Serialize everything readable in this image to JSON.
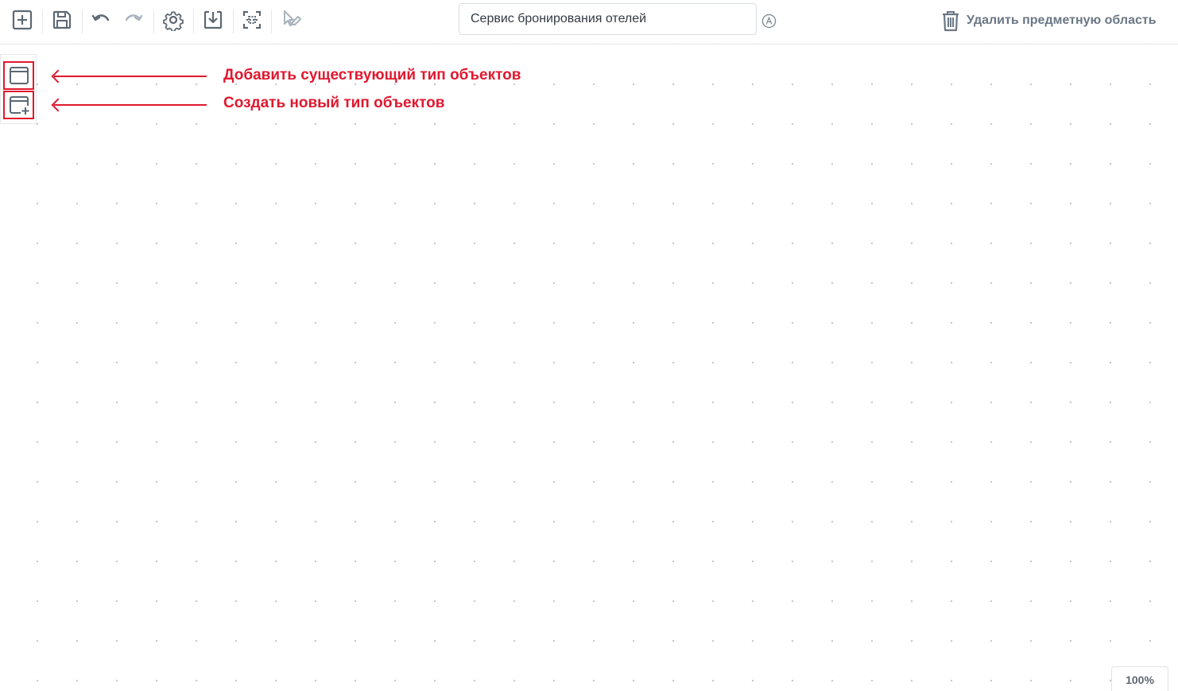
{
  "toolbar": {
    "buttons": [
      {
        "name": "new-button",
        "icon": "plus-square-icon"
      },
      {
        "name": "save-button",
        "icon": "floppy-disk-icon"
      },
      {
        "name": "undo-button",
        "icon": "undo-icon"
      },
      {
        "name": "redo-button",
        "icon": "redo-icon",
        "disabled": true
      },
      {
        "name": "settings-button",
        "icon": "gear-icon"
      },
      {
        "name": "download-button",
        "icon": "download-icon"
      },
      {
        "name": "fit-view-button",
        "icon": "fit-view-icon"
      },
      {
        "name": "edit-tool-button",
        "icon": "pencil-cursor-icon",
        "disabled": true
      }
    ],
    "title_value": "Сервис бронирования отелей",
    "auto_icon": "circle-a-icon",
    "delete_label": "Удалить предметную область",
    "delete_icon": "trash-icon"
  },
  "side_panel": {
    "add_existing_icon": "window-icon",
    "create_new_icon": "window-plus-icon"
  },
  "annotations": {
    "add_existing": "Добавить существующий тип объектов",
    "create_new": "Создать новый тип объектов",
    "color": "#e0182f"
  },
  "zoom": {
    "label": "100%",
    "value_percent": 100
  },
  "colors": {
    "icon": "#5d6873",
    "icon_disabled": "#a9b3bd",
    "accent_annotation": "#e0182f",
    "grid_dot": "#c4c9cf"
  }
}
